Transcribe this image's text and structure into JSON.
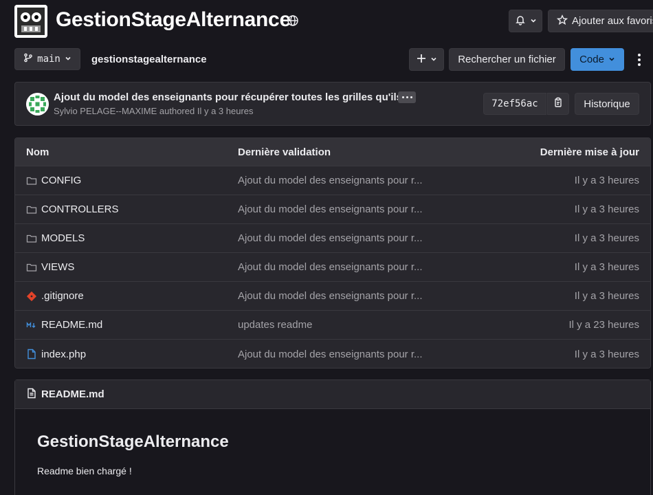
{
  "header": {
    "repo_title": "GestionStageAlternance",
    "visibility_icon": "globe-icon",
    "notifications_icon": "bell-icon",
    "star_label": "Ajouter aux favoris"
  },
  "toolbar": {
    "branch": "main",
    "breadcrumb": "gestionstagealternance",
    "add_icon": "plus-icon",
    "search_file_label": "Rechercher un fichier",
    "code_label": "Code"
  },
  "commit": {
    "title": "Ajout du model des enseignants pour récupérer toutes les grilles qu'ils...",
    "author": "Sylvio PELAGE--MAXIME",
    "action": "authored",
    "time": "Il y a 3 heures",
    "sha": "72ef56ac",
    "history_label": "Historique"
  },
  "files": {
    "headers": {
      "name": "Nom",
      "last_commit": "Dernière validation",
      "last_update": "Dernière mise à jour"
    },
    "rows": [
      {
        "name": "CONFIG",
        "type": "folder",
        "commit": "Ajout du model des enseignants pour r...",
        "date": "Il y a 3 heures"
      },
      {
        "name": "CONTROLLERS",
        "type": "folder",
        "commit": "Ajout du model des enseignants pour r...",
        "date": "Il y a 3 heures"
      },
      {
        "name": "MODELS",
        "type": "folder",
        "commit": "Ajout du model des enseignants pour r...",
        "date": "Il y a 3 heures"
      },
      {
        "name": "VIEWS",
        "type": "folder",
        "commit": "Ajout du model des enseignants pour r...",
        "date": "Il y a 3 heures"
      },
      {
        "name": ".gitignore",
        "type": "git",
        "commit": "Ajout du model des enseignants pour r...",
        "date": "Il y a 3 heures"
      },
      {
        "name": "README.md",
        "type": "markdown",
        "commit": "updates readme",
        "date": "Il y a 23 heures"
      },
      {
        "name": "index.php",
        "type": "file",
        "commit": "Ajout du model des enseignants pour r...",
        "date": "Il y a 3 heures"
      }
    ]
  },
  "readme": {
    "filename": "README.md",
    "heading": "GestionStageAlternance",
    "body": "Readme bien chargé !"
  },
  "colors": {
    "background": "#18171d",
    "panel": "#28272d",
    "accent": "#428fdc",
    "git_orange": "#e24329"
  }
}
